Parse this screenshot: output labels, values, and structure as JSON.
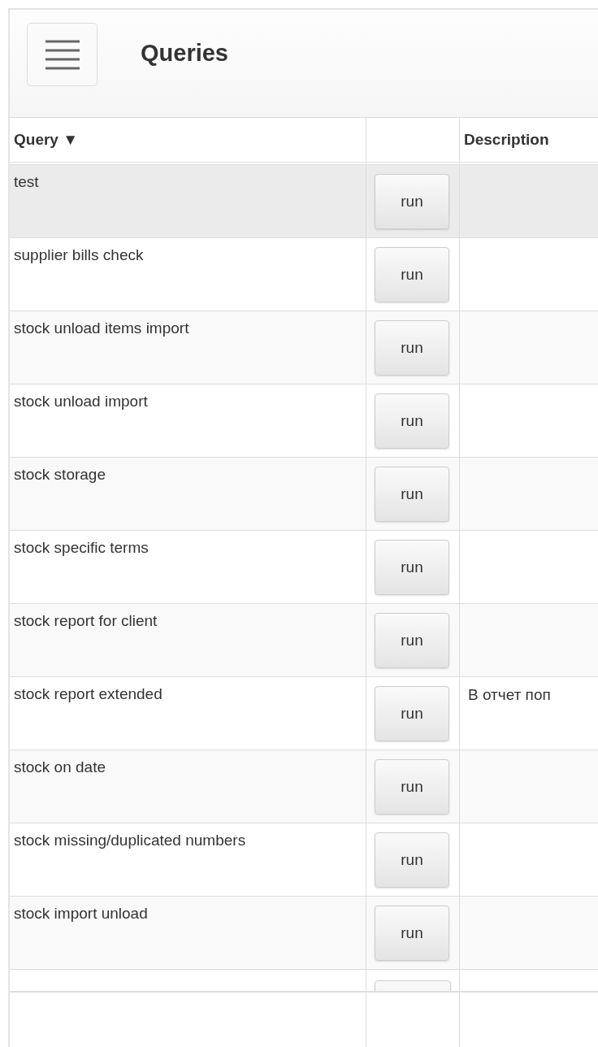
{
  "header": {
    "title": "Queries"
  },
  "table": {
    "columns": [
      {
        "label": "Query",
        "sort_icon": "▼"
      },
      {},
      {
        "label": "Description"
      }
    ],
    "rows": [
      {
        "query": "test",
        "action": "run",
        "selected": true
      },
      {
        "query": "supplier bills check",
        "action": "run",
        "selected": false
      },
      {
        "query": "stock unload items import",
        "action": "run",
        "selected": false
      },
      {
        "query": "stock unload import",
        "action": "run",
        "selected": false
      },
      {
        "query": "stock storage",
        "action": "run",
        "selected": false
      },
      {
        "query": "stock specific terms",
        "action": "run",
        "selected": false
      },
      {
        "query": "stock report for client",
        "action": "run",
        "selected": false
      },
      {
        "query": "stock report extended",
        "action": "run",
        "description": "В отчет поп",
        "selected": false
      },
      {
        "query": "stock on date",
        "action": "run",
        "selected": false
      },
      {
        "query": "stock missing/duplicated numbers",
        "action": "run",
        "selected": false
      },
      {
        "query": "stock import unload",
        "action": "run",
        "selected": false
      }
    ]
  }
}
